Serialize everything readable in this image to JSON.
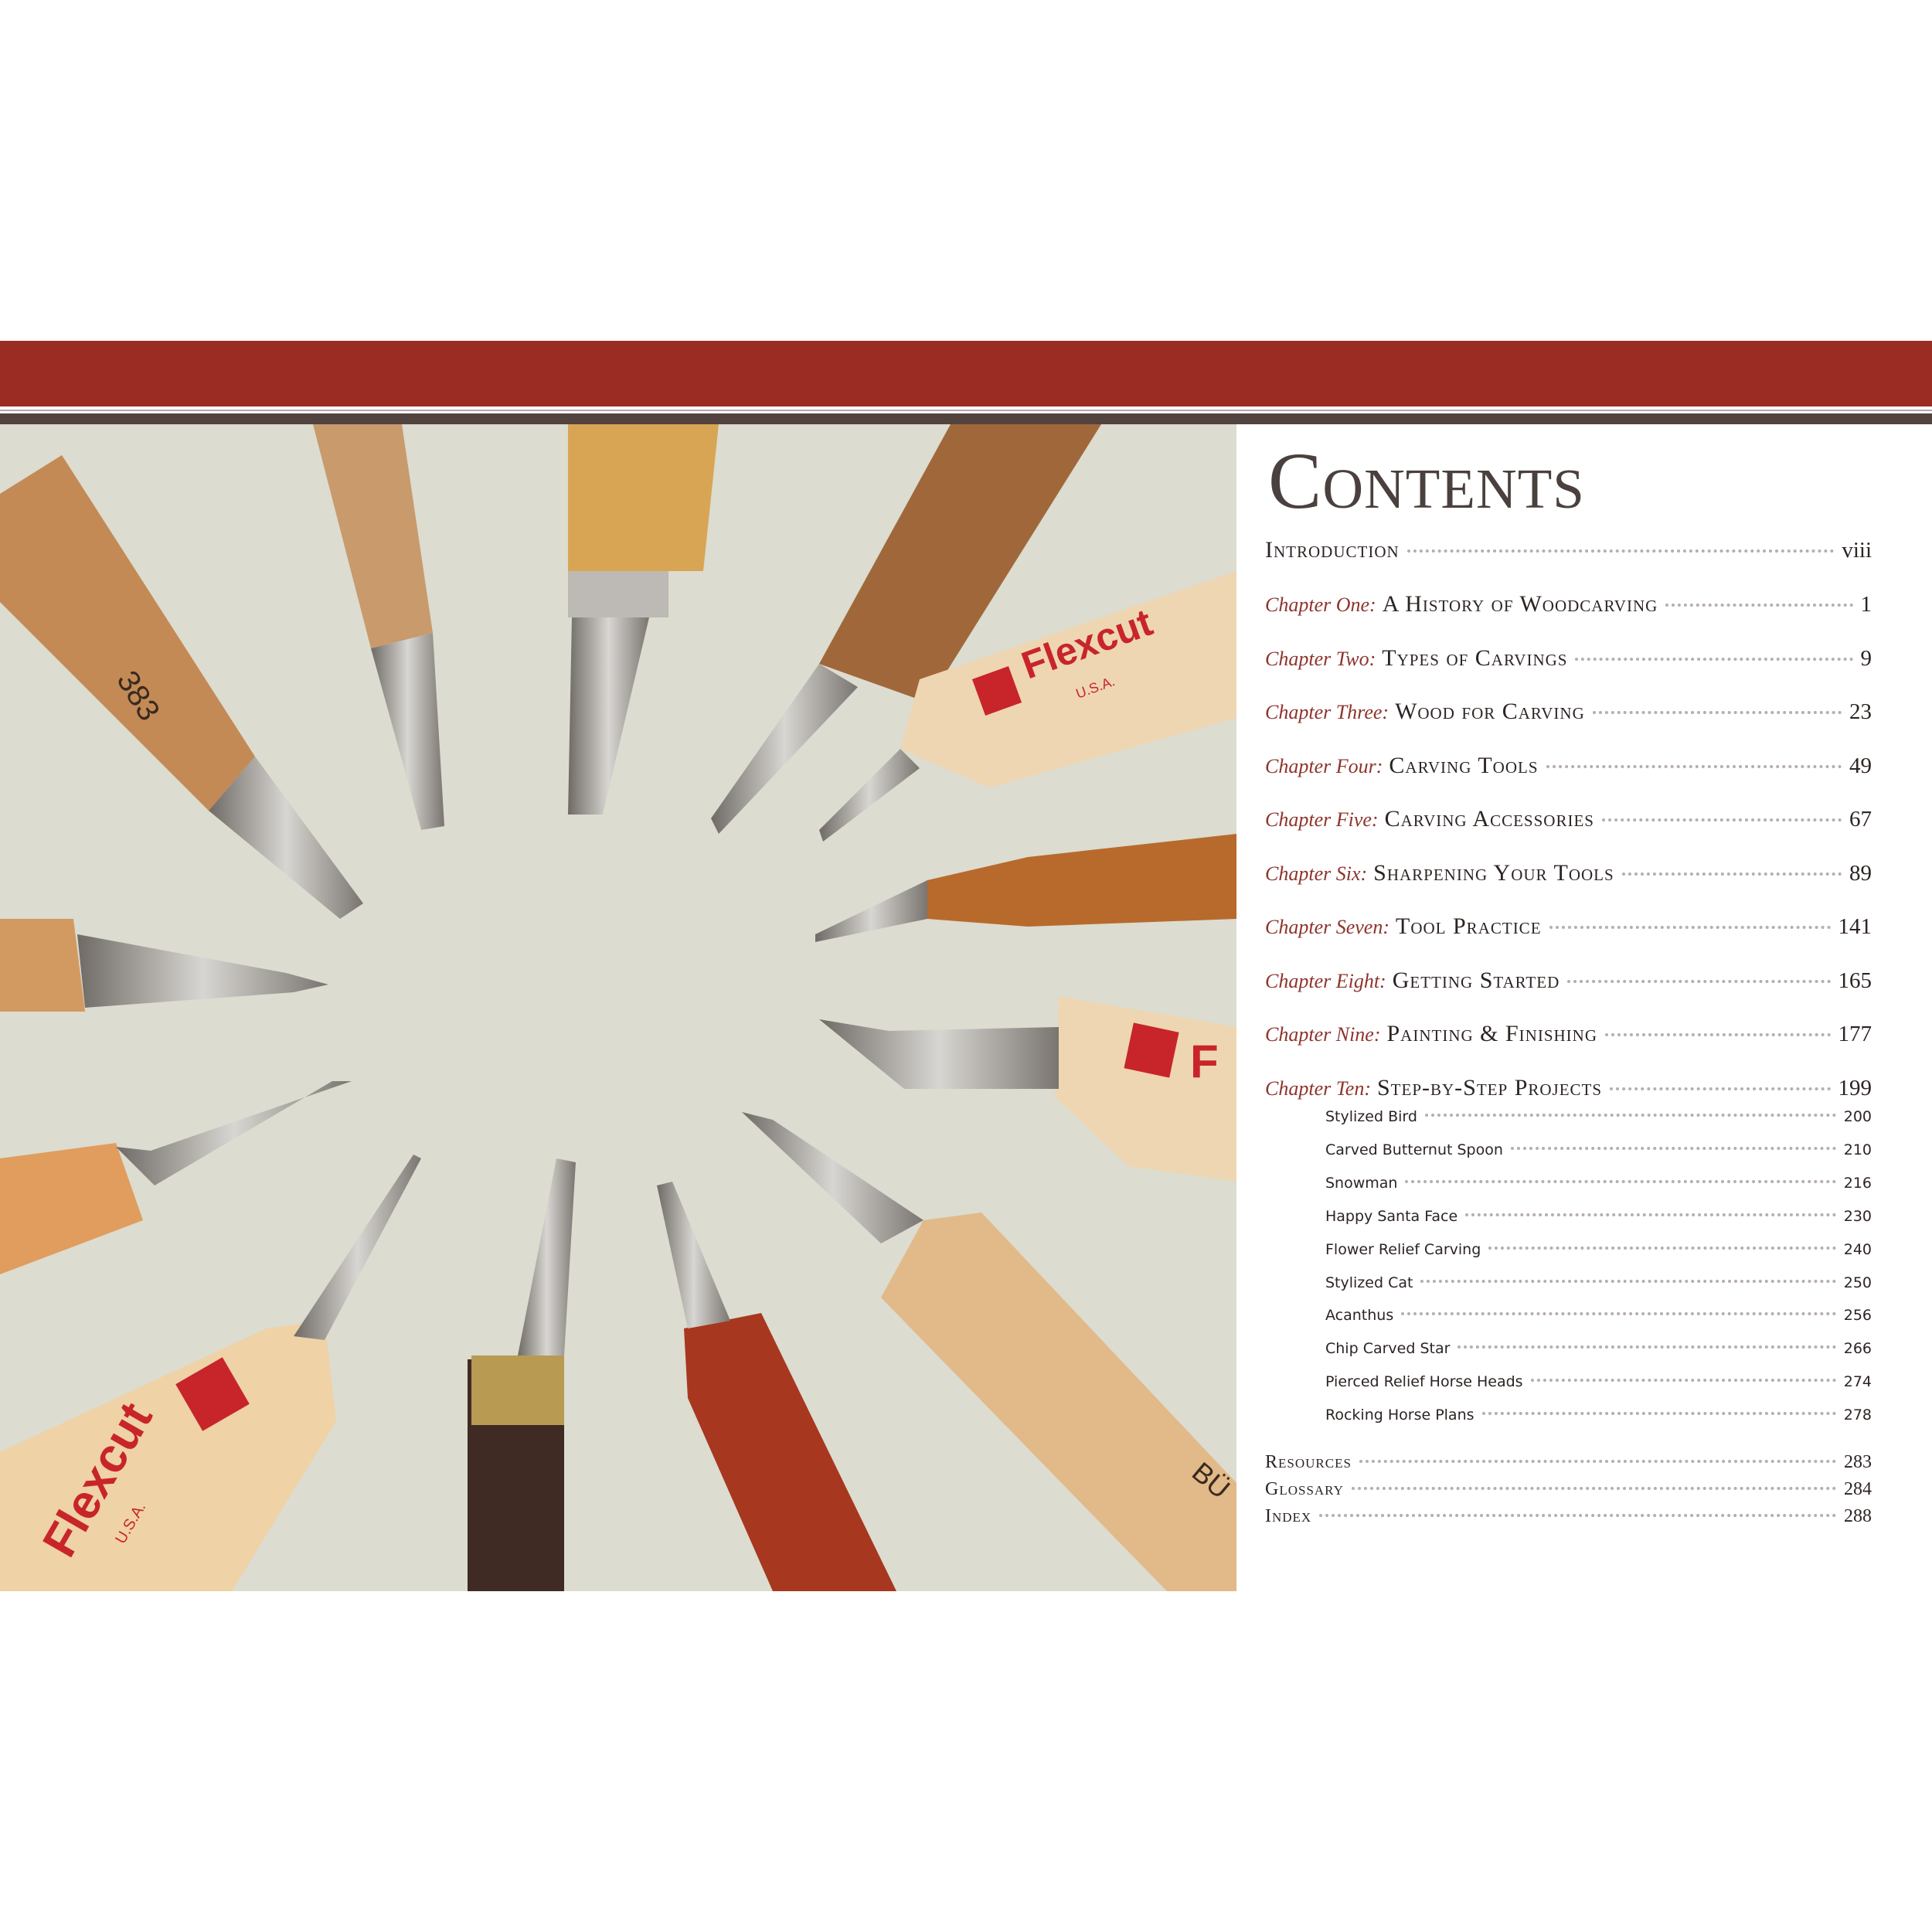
{
  "toc": {
    "title": "Contents",
    "intro": {
      "title": "Introduction",
      "page": "viii"
    },
    "chapters": [
      {
        "label": "Chapter One:",
        "title": "A History of Woodcarving",
        "page": "1"
      },
      {
        "label": "Chapter Two:",
        "title": "Types of Carvings",
        "page": "9"
      },
      {
        "label": "Chapter Three:",
        "title": "Wood for Carving",
        "page": "23"
      },
      {
        "label": "Chapter Four:",
        "title": "Carving Tools",
        "page": "49"
      },
      {
        "label": "Chapter Five:",
        "title": "Carving Accessories",
        "page": "67"
      },
      {
        "label": "Chapter Six:",
        "title": "Sharpening Your Tools",
        "page": "89"
      },
      {
        "label": "Chapter Seven:",
        "title": "Tool Practice",
        "page": "141"
      },
      {
        "label": "Chapter Eight:",
        "title": "Getting Started",
        "page": "165"
      },
      {
        "label": "Chapter Nine:",
        "title": "Painting & Finishing",
        "page": "177"
      },
      {
        "label": "Chapter Ten:",
        "title": "Step-by-Step Projects",
        "page": "199"
      }
    ],
    "projects": [
      {
        "title": "Stylized Bird",
        "page": "200"
      },
      {
        "title": "Carved Butternut Spoon",
        "page": "210"
      },
      {
        "title": "Snowman",
        "page": "216"
      },
      {
        "title": "Happy Santa Face",
        "page": "230"
      },
      {
        "title": "Flower Relief Carving",
        "page": "240"
      },
      {
        "title": "Stylized Cat",
        "page": "250"
      },
      {
        "title": "Acanthus",
        "page": "256"
      },
      {
        "title": "Chip Carved Star",
        "page": "266"
      },
      {
        "title": "Pierced Relief Horse Heads",
        "page": "274"
      },
      {
        "title": "Rocking Horse Plans",
        "page": "278"
      }
    ],
    "back_matter": [
      {
        "title": "Resources",
        "page": "283"
      },
      {
        "title": "Glossary",
        "page": "284"
      },
      {
        "title": "Index",
        "page": "288"
      }
    ]
  },
  "photo": {
    "brand_top": "Flexcut",
    "brand_left": "Flexcut",
    "brand_right": "F",
    "sub_top": "U.S.A.",
    "sub_left": "U.S.A.",
    "handle_mark": "383",
    "handle_mark_2": "BÜ"
  },
  "colors": {
    "accent": "#9b2c24",
    "band_dark": "#52433f",
    "chapter_label": "#8e342c"
  }
}
